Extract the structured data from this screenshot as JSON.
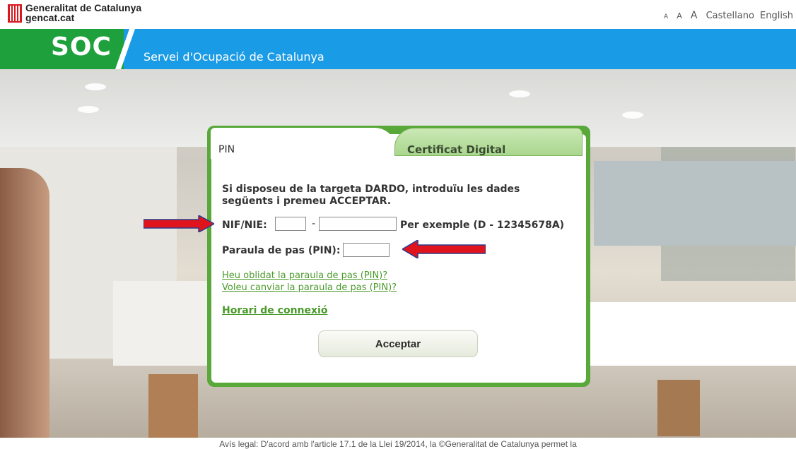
{
  "header": {
    "org_line1": "Generalitat de Catalunya",
    "org_line2": "gencat.cat",
    "font_small": "A",
    "font_medium": "A",
    "font_large": "A",
    "lang_es": "Castellano",
    "lang_en": "English"
  },
  "band": {
    "logo": "SOC",
    "title": "Servei d'Ocupació de Catalunya",
    "colors": {
      "blue": "#1a9be6",
      "green": "#1ea03c"
    }
  },
  "login": {
    "tabs": [
      {
        "label": "PIN",
        "active": true
      },
      {
        "label": "Certificat Digital",
        "active": false
      }
    ],
    "intro": "Si disposeu de la targeta DARDO, introduïu les dades següents i premeu ACCEPTAR.",
    "nif_label": "NIF/NIE:",
    "nif_dash": "-",
    "nif_example": "Per exemple (D - 12345678A)",
    "pin_label": "Paraula de pas (PIN):",
    "links": {
      "forgot": "Heu oblidat la paraula de pas (PIN)?",
      "change": "Voleu canviar la paraula de pas (PIN)?",
      "schedule": "Horari de connexió"
    },
    "submit": "Acceptar",
    "colors": {
      "panel": "#58a83a",
      "link": "#4a9a2a",
      "arrow": "#e0141c"
    }
  },
  "footer": {
    "legal": "Avís legal: D'acord amb l'article 17.1 de la Llei 19/2014, la ©Generalitat de Catalunya permet la"
  }
}
